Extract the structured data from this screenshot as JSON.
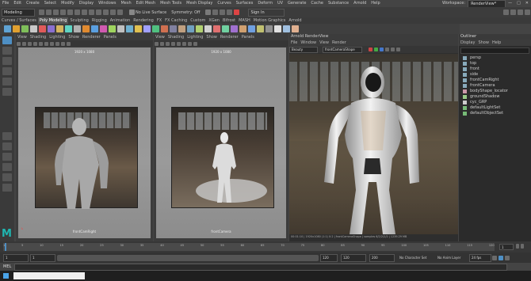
{
  "menubar": {
    "items": [
      "File",
      "Edit",
      "Create",
      "Select",
      "Modify",
      "Display",
      "Windows",
      "Mesh",
      "Edit Mesh",
      "Mesh Tools",
      "Mesh Display",
      "Curves",
      "Surfaces",
      "Deform",
      "UV",
      "Generate",
      "Cache",
      "Substance",
      "Arnold",
      "Help"
    ],
    "workspace_label": "Workspace:",
    "workspace_value": "RenderView*"
  },
  "statusline": {
    "mode_menu": "Modeling",
    "live_surface": "No Live Surface",
    "symmetry": "Symmetry: Off",
    "sign_in": "Sign In"
  },
  "shelf": {
    "tabs": [
      "Curves / Surfaces",
      "Poly Modeling",
      "Sculpting",
      "Rigging",
      "Animation",
      "Rendering",
      "FX",
      "FX Caching",
      "Custom",
      "XGen",
      "Bifrost",
      "MASH",
      "Motion Graphics",
      "Arnold"
    ],
    "active_tab": "Poly Modeling",
    "icon_colors": [
      "#5fa3d4",
      "#e0a030",
      "#7fbf5a",
      "#c8c8c8",
      "#e05a5a",
      "#8a6fd0",
      "#d4b45f",
      "#5fd4c4",
      "#b0b0b0",
      "#e08a30",
      "#5a9fe0",
      "#d05ab0",
      "#9fd45f",
      "#c0c0c0",
      "#6fb0d0",
      "#e0c050",
      "#a0a0ff",
      "#50c080",
      "#d07050",
      "#8080a0",
      "#c0a080",
      "#70a0c0",
      "#b0d070",
      "#d0d0d0",
      "#e07070",
      "#70d0a0",
      "#a070d0",
      "#d0a070",
      "#70a0e0",
      "#c0c070",
      "#909090",
      "#e0e0e0",
      "#a0c0e0",
      "#e0b090"
    ]
  },
  "viewport_left": {
    "menu": [
      "View",
      "Shading",
      "Lighting",
      "Show",
      "Renderer",
      "Panels"
    ],
    "resolution": "1920 x 1080",
    "camera": "frontCamRight"
  },
  "viewport_mid": {
    "menu": [
      "View",
      "Shading",
      "Lighting",
      "Show",
      "Renderer",
      "Panels"
    ],
    "resolution": "1920 x 1080",
    "camera": "frontCamera"
  },
  "renderview": {
    "title": "Arnold RenderView",
    "menu": [
      "File",
      "Window",
      "View",
      "Render"
    ],
    "display_mode": "Beauty",
    "camera": "frontCameraShape",
    "status": "00:01:10 | 1920x1080 (1:1) 0:2 | frontCameraShape | samples 6/2/2/2/2 | 1239.29 MB"
  },
  "outliner": {
    "title": "Outliner",
    "menu": [
      "Display",
      "Show",
      "Help"
    ],
    "items": [
      "persp",
      "top",
      "front",
      "side",
      "frontCamRight",
      "frontCamera",
      "bodyShape_locator",
      "groundShadow",
      "cyc_GRP",
      "defaultLightSet",
      "defaultObjectSet"
    ]
  },
  "timeline": {
    "ticks": [
      "1",
      "5",
      "10",
      "15",
      "20",
      "25",
      "30",
      "35",
      "40",
      "45",
      "50",
      "55",
      "60",
      "65",
      "70",
      "75",
      "80",
      "85",
      "90",
      "95",
      "100",
      "105",
      "110",
      "115",
      "120"
    ],
    "current_frame": "1",
    "start_frame": "1",
    "range_start": "1",
    "range_end": "120",
    "end_frame": "120",
    "max_frame": "200",
    "character_set": "No Character Set",
    "anim_layer": "No Anim Layer",
    "fps": "24 fps",
    "current_field": "1"
  },
  "mel": {
    "label": "MEL"
  },
  "colors": {
    "accent": "#4e8fc4",
    "maya_logo": "#1fb5b0"
  }
}
